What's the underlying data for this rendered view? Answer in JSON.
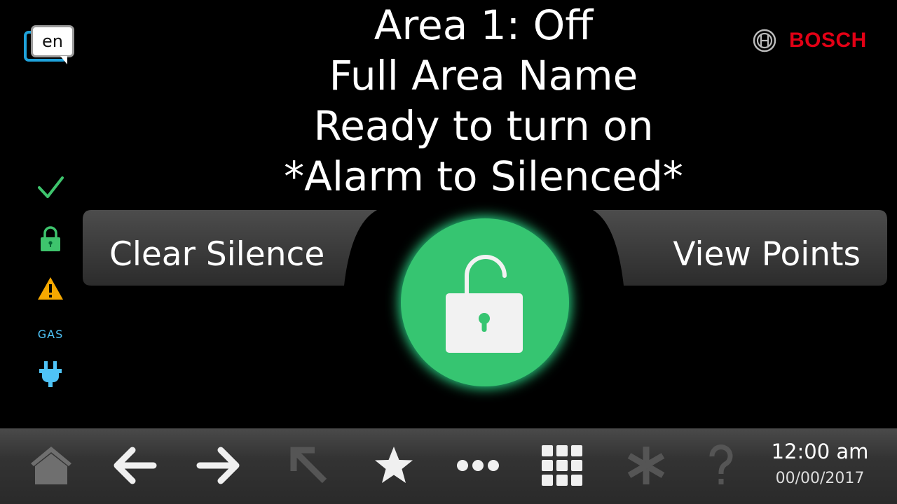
{
  "language": {
    "code": "en",
    "icon": "language-bubble-icon"
  },
  "brand": {
    "name": "BOSCH",
    "color": "#e20015"
  },
  "status": {
    "area_state": "Area 1: Off",
    "area_name": "Full Area Name",
    "readiness": "Ready to turn on",
    "alarm_message": "*Alarm to Silenced*"
  },
  "side_indicators": [
    {
      "icon": "check-icon",
      "color": "#3ec46d"
    },
    {
      "icon": "lock-icon",
      "color": "#3ec46d"
    },
    {
      "icon": "warning-icon",
      "color": "#f6a800"
    },
    {
      "label": "GAS",
      "color": "#4fc3f7"
    },
    {
      "icon": "plug-icon",
      "color": "#4fc3f7"
    }
  ],
  "actions": {
    "left_label": "Clear Silence",
    "right_label": "View Points",
    "center_icon": "unlocked-padlock-icon",
    "center_color": "#36c571"
  },
  "toolbar": {
    "items": [
      "home-icon",
      "back-arrow-icon",
      "forward-arrow-icon",
      "shortcut-arrow-icon",
      "favorites-star-icon",
      "more-icon",
      "keypad-icon",
      "asterisk-icon",
      "help-icon"
    ],
    "time": "12:00 am",
    "date": "00/00/2017"
  }
}
